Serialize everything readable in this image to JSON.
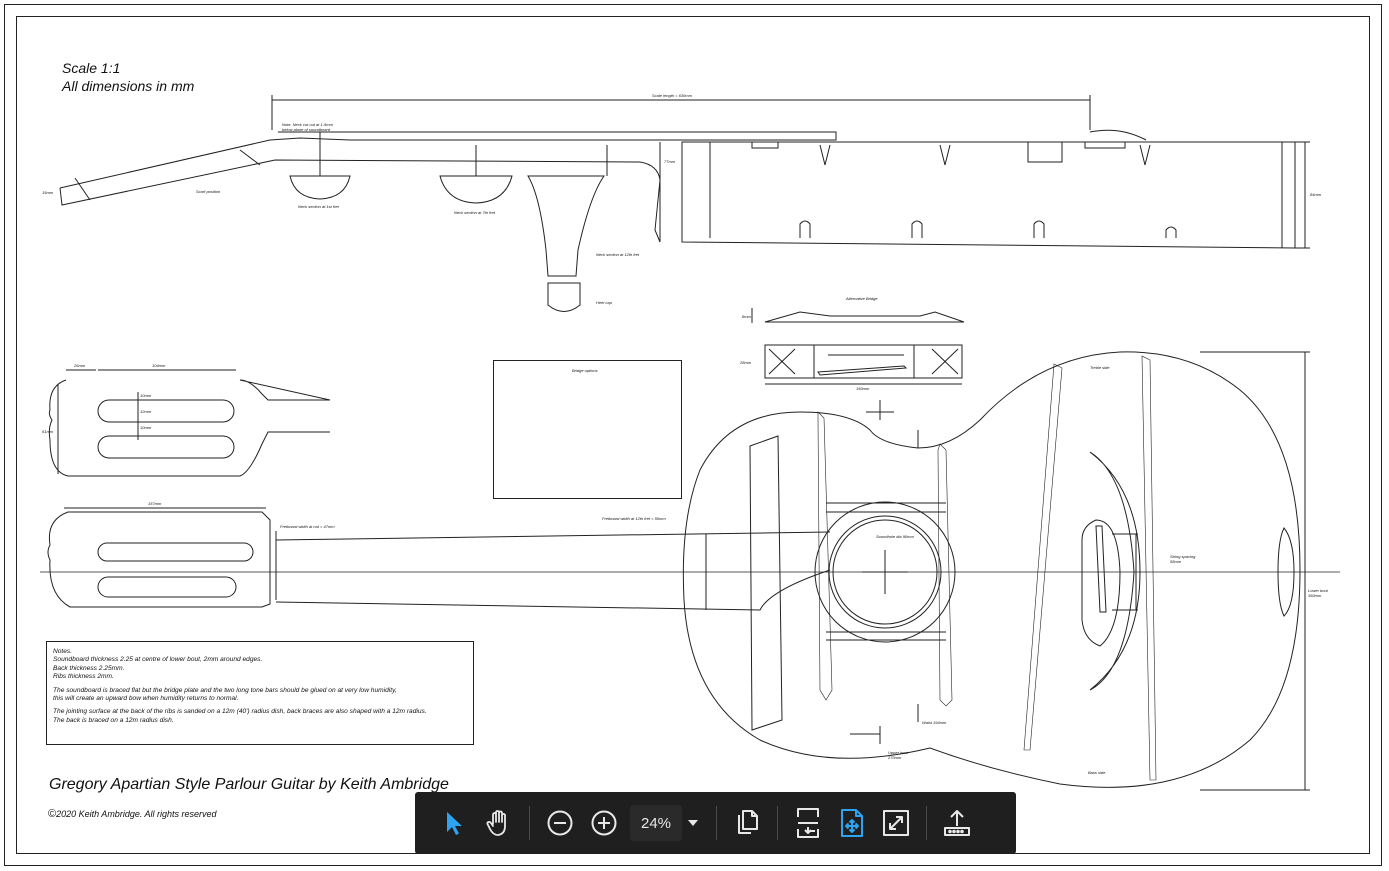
{
  "drawing": {
    "scale_line1": "Scale 1:1",
    "scale_line2": "All dimensions in mm",
    "title": "Gregory Apartian Style Parlour Guitar by Keith Ambridge",
    "copyright": "2020 Keith Ambridge. All rights reserved",
    "labels": {
      "scale_length": "Scale length = 630mm",
      "neck_note_1": "Note, Neck cut out at 1-5mm",
      "neck_note_2": "below plane of soundboard",
      "scarf": "Scarf position",
      "head_thickness": "15mm",
      "neck_section_1": "Neck section at 1st fret",
      "neck_section_7": "Neck section at 7th fret",
      "neck_section_12": "Neck section at 12th fret",
      "heel_cap": "Heel cap",
      "neck_height": "77mm",
      "body_depth": "84mm",
      "alt_bridge": "Alternative Bridge",
      "bridge_height": "8mm",
      "bridge_depth": "28mm",
      "bridge_width": "150mm",
      "head_26": "26mm",
      "head_104": "104mm",
      "head_10a": "10mm",
      "head_12": "12mm",
      "head_10b": "10mm",
      "head_width": "61mm",
      "head_157": "157mm",
      "fb_nut": "Fretboard width at nut = 47mm",
      "fb_12": "Fretboard width at 12th fret = 55mm",
      "bridge_options": "Bridge options",
      "soundhole": "Soundhole dia 90mm",
      "treble": "Treble side",
      "bass": "Bass side",
      "string_spacing_1": "String spacing",
      "string_spacing_2": "58mm",
      "lower_bout_1": "Lower bout",
      "lower_bout_2": "360mm",
      "upper_bout_1": "Upper bout",
      "upper_bout_2": "270mm",
      "waist": "Waist 194mm"
    },
    "notes": {
      "heading": "Notes.",
      "line1": "Soundboard thickness   2.25 at centre of lower bout, 2mm around edges.",
      "line2": "Back thickness          2.25mm.",
      "line3": "Ribs thickness               2mm.",
      "line4": "The soundboard is braced flat but the bridge plate and the two long tone bars should be glued on at very low humidity,",
      "line5": "this will create an upward bow when humidity returns to normal.",
      "line6": "The jointing surface at the back of the ribs is sanded on a 12m (40') radius dish, back braces are also shaped with a 12m radius.",
      "line7": "The back is braced on a 12m radius dish."
    }
  },
  "toolbar": {
    "zoom": "24%",
    "icons": [
      "select-cursor-icon",
      "hand-pan-icon",
      "zoom-out-icon",
      "zoom-in-icon",
      "chevron-down-icon",
      "page-view-icon",
      "fit-width-icon",
      "fit-page-icon",
      "fullscreen-icon",
      "share-upload-icon"
    ],
    "accent": "#2ea3f2"
  }
}
